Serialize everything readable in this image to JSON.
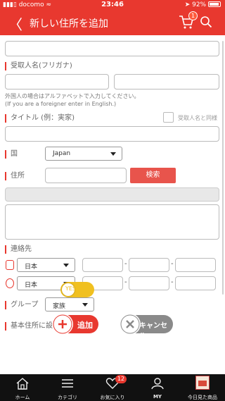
{
  "status_bar": {
    "carrier": "docomo",
    "time": "23:46",
    "battery": "92%"
  },
  "header": {
    "back_icon": "chevron-left-icon",
    "title": "新しい住所を追加",
    "cart_badge": "1"
  },
  "form": {
    "recipient_kana_label": "受取人名(フリガナ)",
    "foreigner_hint_1": "外国人の場合はアルファベットで入力してください。",
    "foreigner_hint_2": "(If you are a foreigner enter in English.)",
    "title_label": "タイトル (例：実家)",
    "same_as_recipient_label": "受取人名と同様",
    "country_label": "国",
    "country_value": "Japan",
    "address_label": "住所",
    "search_button": "検索",
    "contact_label": "連絡先",
    "phone_country_1": "日本",
    "phone_country_2": "日本",
    "phone_separator": "-",
    "group_label": "グループ",
    "group_value": "家族",
    "default_address_label": "基本住所に設定",
    "default_toggle_text": "YES",
    "default_toggle_on": true
  },
  "actions": {
    "add_label": "追加",
    "cancel_label": "キャンセル"
  },
  "tabbar": {
    "home": "ホーム",
    "category": "カテゴリ",
    "favorites": "お気に入り",
    "favorites_badge": "12",
    "my": "MY",
    "recently_viewed": "今日見た商品"
  },
  "colors": {
    "brand_red": "#e8382f",
    "toggle_yellow": "#f0c020",
    "cancel_gray": "#8a8a8a",
    "tabbar_bg": "#111111"
  }
}
